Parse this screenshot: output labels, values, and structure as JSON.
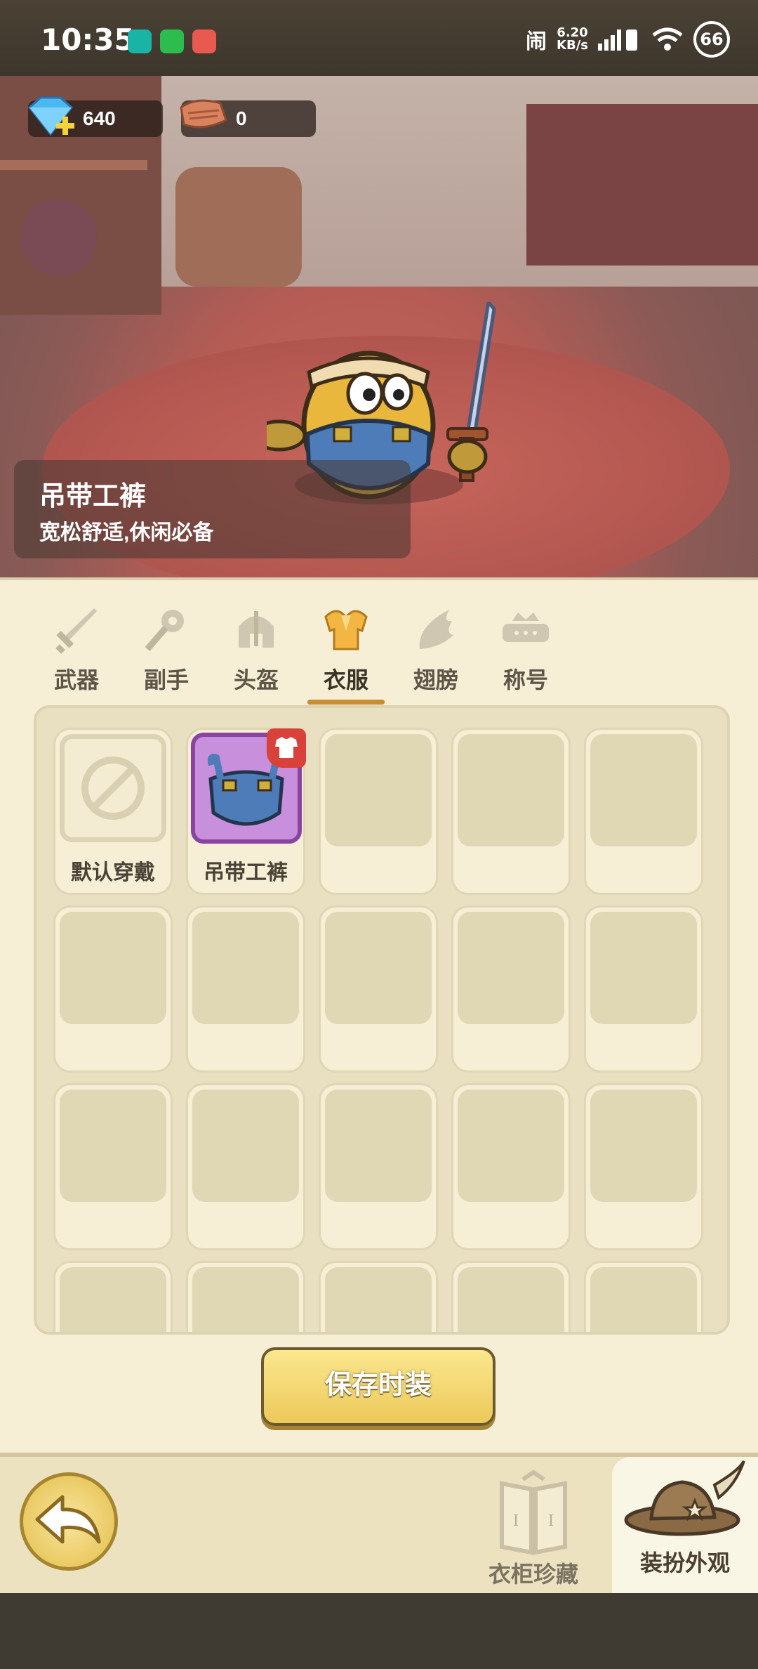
{
  "status_bar": {
    "time": "10:35",
    "net_speed_value": "6.20",
    "net_speed_unit": "KB/s",
    "battery": "66"
  },
  "currency": {
    "diamonds": "640",
    "leather": "0"
  },
  "selected_item": {
    "name": "吊带工裤",
    "description": "宽松舒适,休闲必备"
  },
  "tabs": [
    {
      "label": "武器",
      "icon": "sword-icon"
    },
    {
      "label": "副手",
      "icon": "offhand-icon"
    },
    {
      "label": "头盔",
      "icon": "helmet-icon"
    },
    {
      "label": "衣服",
      "icon": "armor-icon",
      "active": true
    },
    {
      "label": "翅膀",
      "icon": "wings-icon"
    },
    {
      "label": "称号",
      "icon": "title-banner-icon"
    }
  ],
  "slots": [
    {
      "label": "默认穿戴",
      "type": "default"
    },
    {
      "label": "吊带工裤",
      "type": "overalls"
    }
  ],
  "buttons": {
    "save": "保存时装",
    "wardrobe": "衣柜珍藏",
    "appearance": "装扮外观"
  },
  "colors": {
    "panel_bg": "#f6efd6",
    "tab_active_underline": "#c98d35",
    "rare_item_frame": "#8a44a0",
    "badge_red": "#d9413b"
  }
}
